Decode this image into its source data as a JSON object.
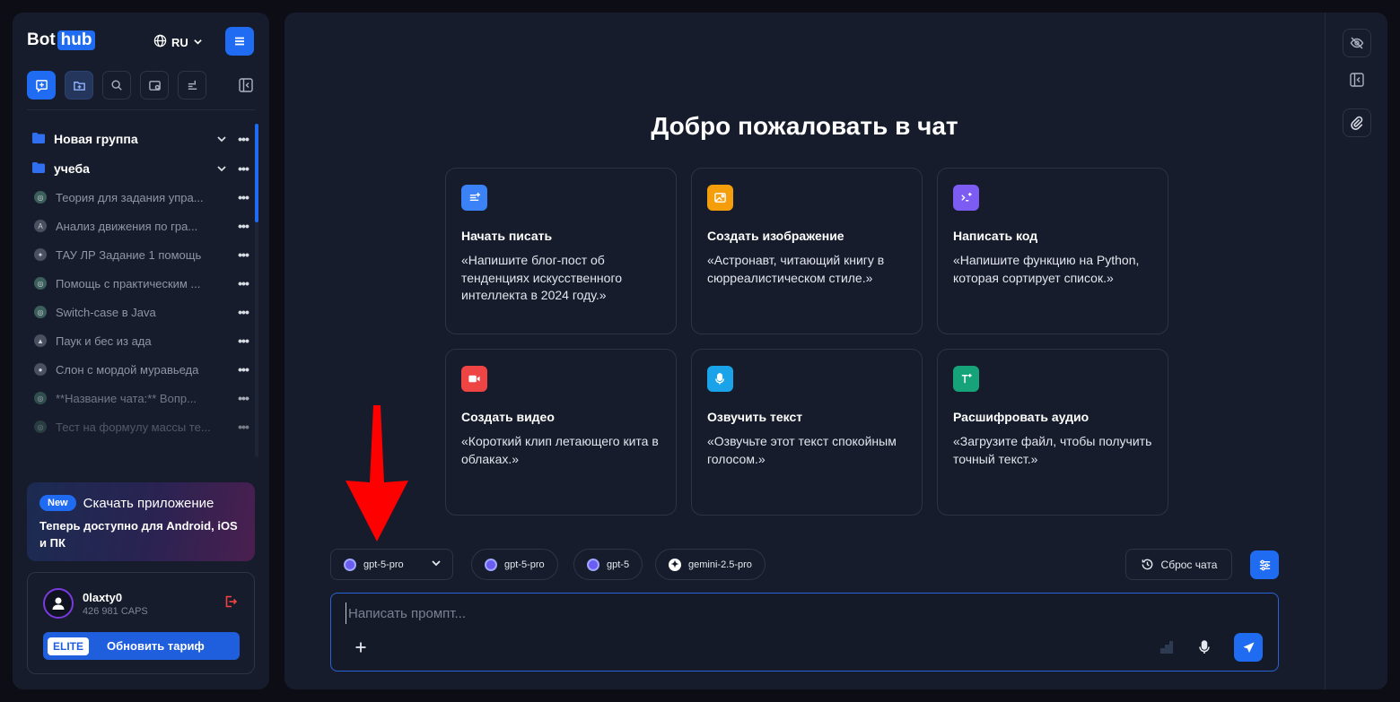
{
  "sidebar": {
    "brand": {
      "name_part1": "Bot",
      "name_part2": "hub"
    },
    "language": "RU",
    "groups": [
      {
        "label": "Новая группа"
      },
      {
        "label": "учеба"
      }
    ],
    "chats": [
      {
        "label": "Теория для задания упра..."
      },
      {
        "label": "Анализ движения по гра..."
      },
      {
        "label": "ТАУ ЛР Задание 1 помощь"
      },
      {
        "label": "Помощь с практическим ..."
      },
      {
        "label": "Switch-case в Java"
      },
      {
        "label": "Паук и бес из ада"
      },
      {
        "label": "Слон с мордой муравьеда"
      },
      {
        "label": "**Название чата:** Вопр..."
      },
      {
        "label": "Тест на формулу массы те..."
      }
    ],
    "row_menu": "•••",
    "promo": {
      "badge": "New",
      "title": "Скачать приложение",
      "subtitle": "Теперь доступно для Android, iOS и ПК"
    },
    "account": {
      "username": "0laxty0",
      "balance": "426 981 CAPS",
      "plan_badge": "ELITE",
      "upgrade_label": "Обновить тариф"
    }
  },
  "main": {
    "welcome_title": "Добро пожаловать в чат",
    "cards": [
      {
        "title": "Начать писать",
        "desc": "«Напишите блог-пост об тенденциях искусственного интеллекта в 2024 году.»",
        "icon": "write-icon",
        "color": "#3b82f6"
      },
      {
        "title": "Создать изображение",
        "desc": "«Астронавт, читающий книгу в сюрреалистическом стиле.»",
        "icon": "image-icon",
        "color": "#f59e0b"
      },
      {
        "title": "Написать код",
        "desc": "«Напишите функцию на Python, которая сортирует список.»",
        "icon": "code-icon",
        "color": "#7c5cf2"
      },
      {
        "title": "Создать видео",
        "desc": "«Короткий клип летающего кита в облаках.»",
        "icon": "video-icon",
        "color": "#ef4444"
      },
      {
        "title": "Озвучить текст",
        "desc": "«Озвучьте этот текст спокойным голосом.»",
        "icon": "microphone-icon",
        "color": "#1aa3e8"
      },
      {
        "title": "Расшифровать аудио",
        "desc": "«Загрузите файл, чтобы получить точный текст.»",
        "icon": "transcribe-icon",
        "color": "#16a37a"
      }
    ],
    "model_selected": "gpt-5-pro",
    "model_chips": [
      "gpt-5-pro",
      "gpt-5",
      "gemini-2.5-pro"
    ],
    "reset_label": "Сброс чата",
    "prompt_placeholder": "Написать промпт..."
  },
  "colors": {
    "accent": "#1f6bf2",
    "sidebar_bg": "#161c2b",
    "page_bg": "#0d0d15",
    "annotation_arrow": "#ff0000"
  }
}
